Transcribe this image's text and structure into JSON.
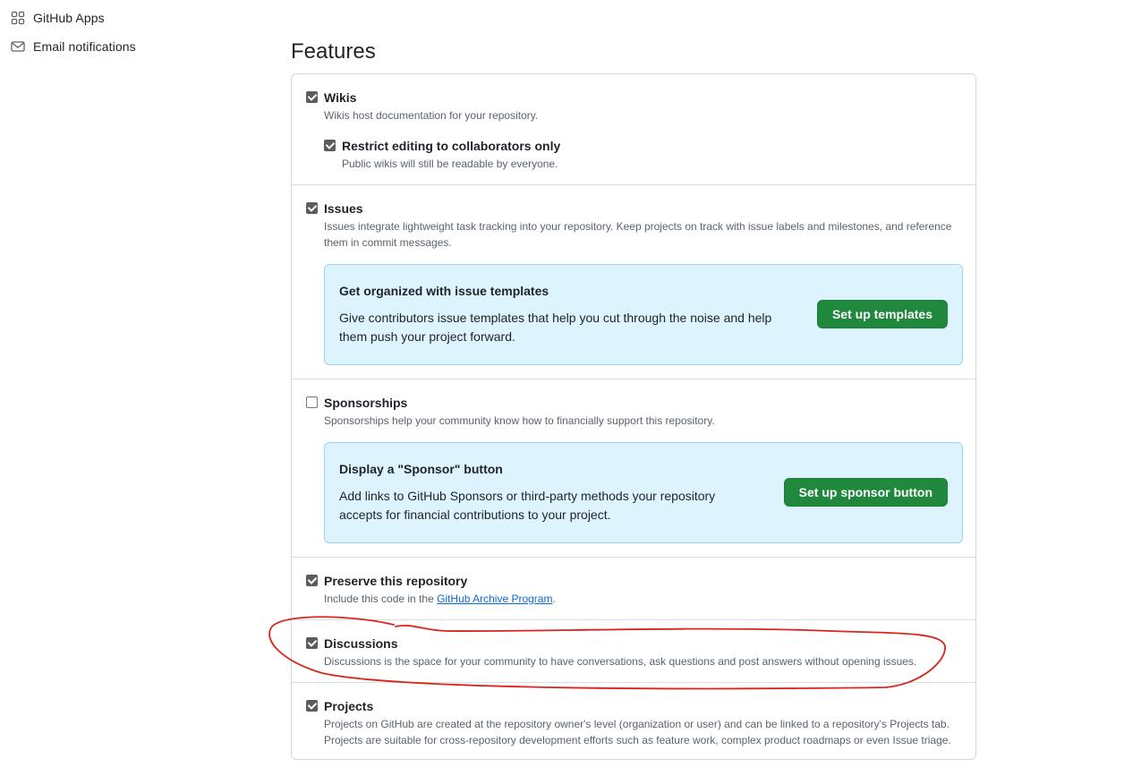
{
  "sidebar": {
    "items": [
      {
        "label": "GitHub Apps",
        "icon": "apps-icon"
      },
      {
        "label": "Email notifications",
        "icon": "mail-icon"
      }
    ]
  },
  "main": {
    "title": "Features",
    "wikis": {
      "label": "Wikis",
      "checked": true,
      "description": "Wikis host documentation for your repository.",
      "restrict": {
        "label": "Restrict editing to collaborators only",
        "checked": true,
        "description": "Public wikis will still be readable by everyone."
      }
    },
    "issues": {
      "label": "Issues",
      "checked": true,
      "description_line1": "Issues integrate lightweight task tracking into your repository. Keep projects on track with issue labels and milestones, and reference",
      "description_line2": "them in commit messages.",
      "callout": {
        "title": "Get organized with issue templates",
        "text_line1": "Give contributors issue templates that help you cut through the noise and help",
        "text_line2": "them push your project forward.",
        "button": "Set up templates"
      }
    },
    "sponsorships": {
      "label": "Sponsorships",
      "checked": false,
      "description": "Sponsorships help your community know how to financially support this repository.",
      "callout": {
        "title": "Display a \"Sponsor\" button",
        "text_line1": "Add links to GitHub Sponsors or third-party methods your repository",
        "text_line2": "accepts for financial contributions to your project.",
        "button": "Set up sponsor button"
      }
    },
    "preserve": {
      "label": "Preserve this repository",
      "checked": true,
      "description_prefix": "Include this code in the ",
      "link": "GitHub Archive Program",
      "description_suffix": "."
    },
    "discussions": {
      "label": "Discussions",
      "checked": true,
      "description": "Discussions is the space for your community to have conversations, ask questions and post answers without opening issues."
    },
    "projects": {
      "label": "Projects",
      "checked": true,
      "description_line1": "Projects on GitHub are created at the repository owner's level (organization or user) and can be linked to a repository's Projects tab.",
      "description_line2": "Projects are suitable for cross-repository development efforts such as feature work, complex product roadmaps or even Issue triage."
    }
  },
  "colors": {
    "button_green": "#1f883d",
    "callout_bg": "#ddf4ff",
    "link_blue": "#0969da",
    "annotation_red": "#d9251c"
  }
}
